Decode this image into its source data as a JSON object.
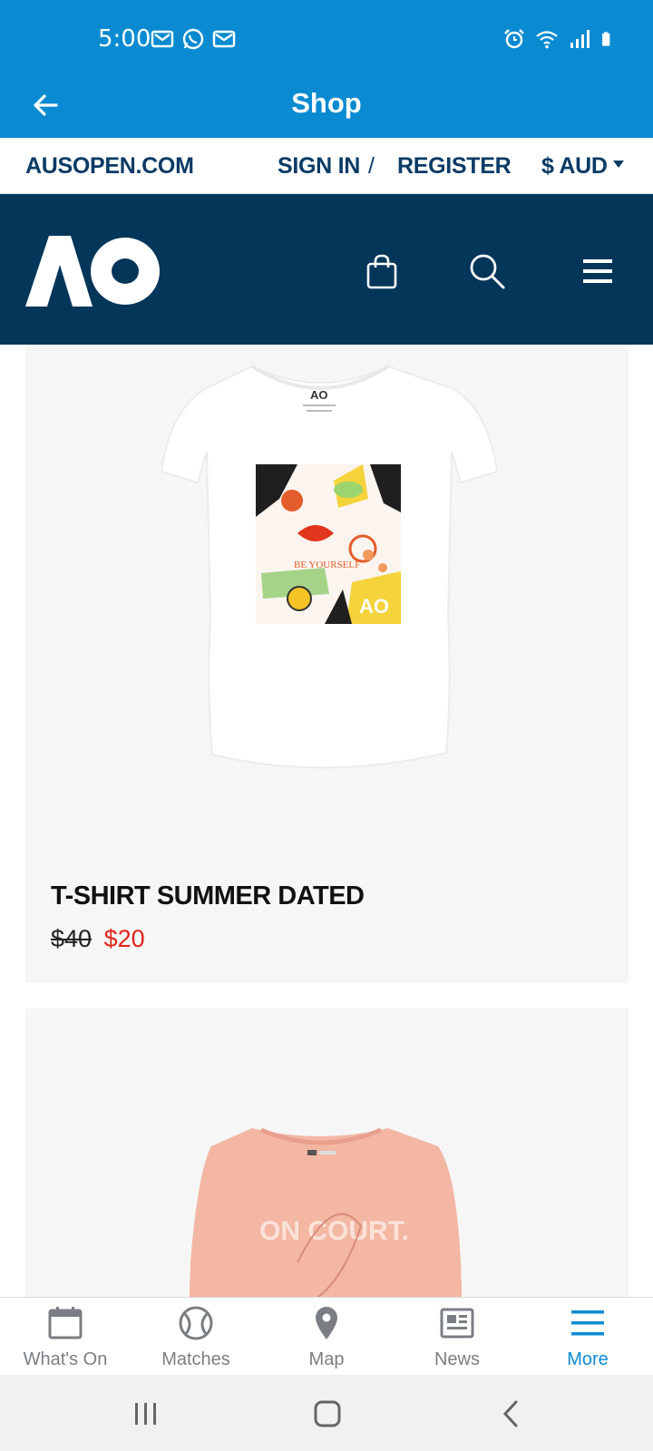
{
  "status_bar": {
    "time": "5:00",
    "left_icons": [
      "gmail-icon",
      "whatsapp-icon",
      "mail-icon"
    ],
    "right_icons": [
      "alarm-icon",
      "wifi-icon",
      "signal-icon",
      "battery-icon"
    ]
  },
  "header": {
    "title": "Shop",
    "back_icon": "back-arrow-icon"
  },
  "top_links": {
    "site": "AUSOPEN.COM",
    "sign_in": "SIGN IN",
    "separator": "/",
    "register": "REGISTER",
    "currency": "$ AUD"
  },
  "brand_bar": {
    "logo": "AO",
    "icons": [
      "shopping-bag-icon",
      "search-icon",
      "menu-icon"
    ]
  },
  "products": [
    {
      "name": "T-SHIRT SUMMER DATED",
      "old_price": "$40",
      "new_price": "$20",
      "image_text": "BE YOURSELF"
    },
    {
      "name": "",
      "image_text": "ON COURT."
    }
  ],
  "bottom_nav": [
    {
      "label": "What's On",
      "icon": "calendar-icon",
      "active": false
    },
    {
      "label": "Matches",
      "icon": "tennis-ball-icon",
      "active": false
    },
    {
      "label": "Map",
      "icon": "map-pin-icon",
      "active": false
    },
    {
      "label": "News",
      "icon": "news-icon",
      "active": false
    },
    {
      "label": "More",
      "icon": "hamburger-icon",
      "active": true
    }
  ],
  "colors": {
    "app_blue": "#0a8bd1",
    "navy": "#04365a",
    "sale_red": "#e2231a",
    "link_navy": "#0b3b66"
  }
}
